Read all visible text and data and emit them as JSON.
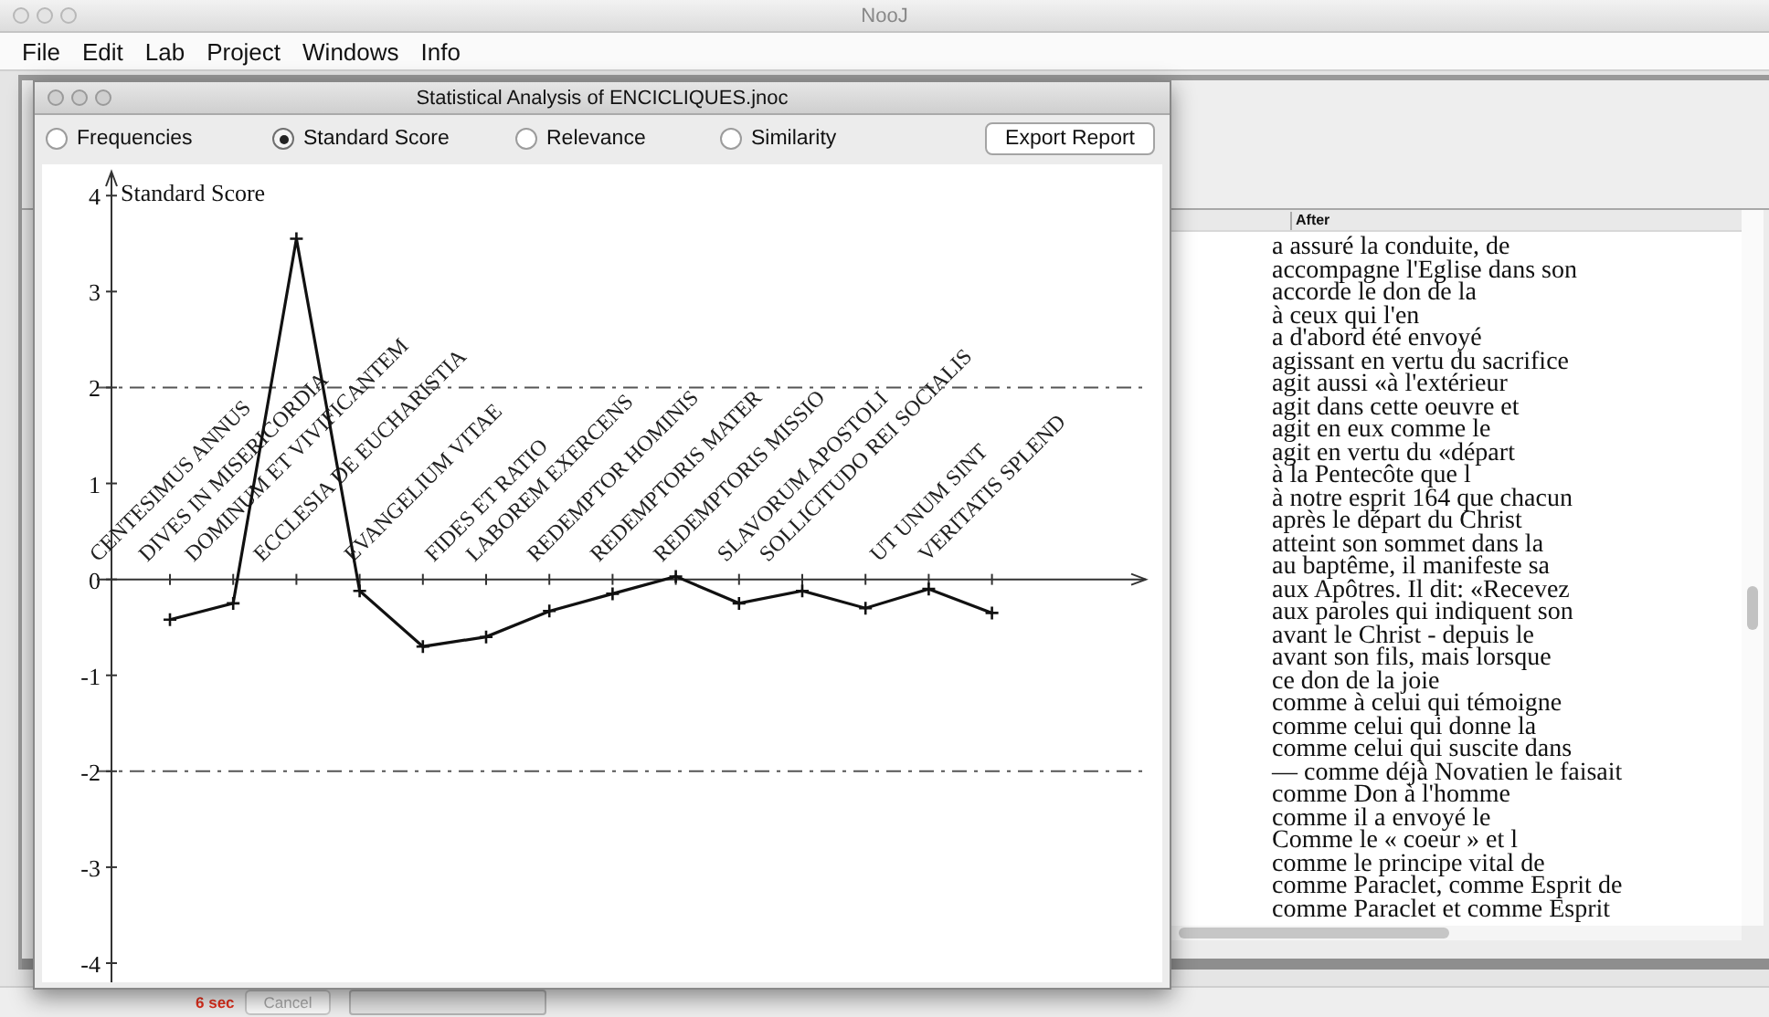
{
  "app": {
    "title": "NooJ"
  },
  "menu": [
    "File",
    "Edit",
    "Lab",
    "Project",
    "Windows",
    "Info"
  ],
  "analysis_window": {
    "title": "Statistical Analysis of ENCICLIQUES.jnoc",
    "modes": [
      {
        "label": "Frequencies",
        "selected": false
      },
      {
        "label": "Standard Score",
        "selected": true
      },
      {
        "label": "Relevance",
        "selected": false
      },
      {
        "label": "Similarity",
        "selected": false
      }
    ],
    "export_button": "Export Report",
    "chart_data": {
      "type": "line",
      "ylabel": "Standard Score",
      "categories": [
        "CENTESIMUS ANNUS",
        "DIVES IN MISERICORDIA",
        "DOMINUM ET VIVIFICANTEM",
        "ECCLESIA DE EUCHARISTIA",
        "EVANGELIUM VITAE",
        "FIDES ET RATIO",
        "LABOREM EXERCENS",
        "REDEMPTOR HOMINIS",
        "REDEMPTORIS MATER",
        "REDEMPTORIS MISSIO",
        "SLAVORUM APOSTOLI",
        "SOLLICITUDO REI SOCIALIS",
        "UT UNUM SINT",
        "VERITATIS SPLEND"
      ],
      "series": [
        {
          "color": "#111111",
          "marker": "+",
          "values": [
            -0.42,
            -0.25,
            3.55,
            -0.12,
            -0.7,
            -0.6,
            -0.33,
            -0.15,
            0.03,
            -0.25,
            -0.12,
            -0.3,
            -0.1,
            -0.35
          ]
        }
      ],
      "ylim": [
        -4.2,
        4.25
      ],
      "yticks": [
        -4,
        -3,
        -2,
        -1,
        0,
        1,
        2,
        3,
        4
      ],
      "ref_lines": [
        {
          "axis": "y",
          "value": 2
        },
        {
          "axis": "y",
          "value": -2
        }
      ]
    }
  },
  "concordance": {
    "columns": [
      "After"
    ],
    "rows": [
      "a assuré la conduite, de",
      "accompagne l'Eglise dans son",
      "accorde le don de la",
      "à ceux qui l'en",
      "a d'abord été envoyé",
      "agissant en vertu du sacrifice",
      "agit aussi «à l'extérieur",
      "agit dans cette oeuvre et",
      "agit en eux comme le",
      "agit en vertu du «départ",
      "à la Pentecôte que l",
      "à notre esprit 164 que chacun",
      "après le départ du Christ",
      "atteint son sommet dans la",
      "au baptême, il manifeste sa",
      "aux Apôtres. Il dit: «Recevez",
      "aux paroles qui indiquent son",
      "avant le Christ - depuis le",
      "avant son fils, mais lorsque",
      "ce don de la joie",
      "comme à celui qui témoigne",
      "comme celui qui donne la",
      "comme celui qui suscite dans",
      "— comme déjà Novatien le faisait",
      "comme Don à l'homme",
      "comme il a envoyé le",
      "Comme le « coeur » et l",
      "comme le principe vital de",
      "comme Paraclet, comme Esprit de",
      "comme Paraclet et comme Esprit"
    ]
  },
  "status_bar": {
    "elapsed": "6 sec",
    "cancel": {
      "label": "Cancel",
      "disabled": true
    }
  }
}
